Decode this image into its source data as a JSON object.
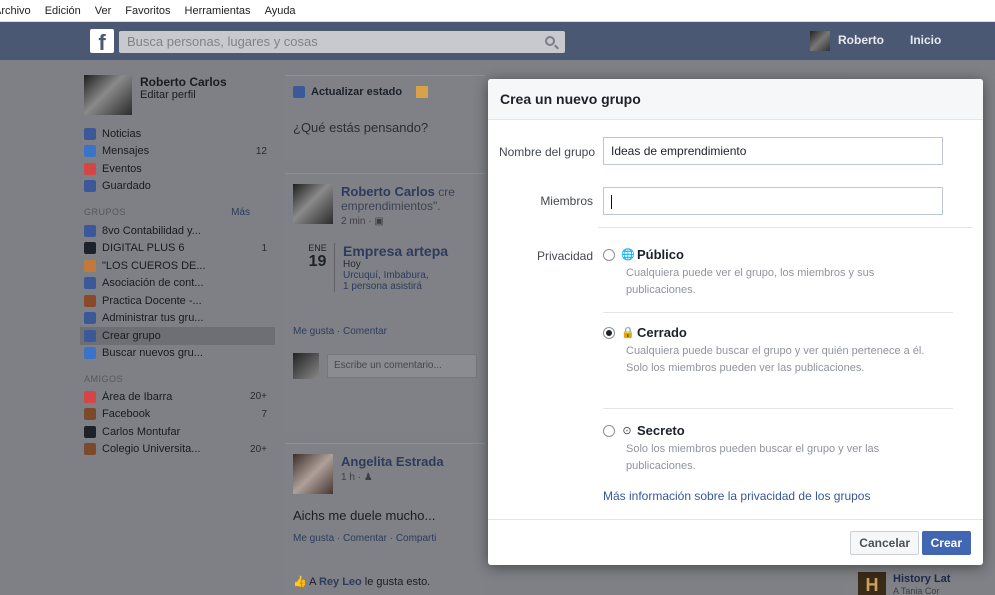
{
  "menubar": {
    "items": [
      "Archivo",
      "Edición",
      "Ver",
      "Favoritos",
      "Herramientas",
      "Ayuda"
    ]
  },
  "topbar": {
    "search_placeholder": "Busca personas, lugares y cosas",
    "user_name": "Roberto",
    "home_label": "Inicio"
  },
  "sidebar": {
    "profile_name": "Roberto Carlos",
    "profile_edit": "Editar perfil",
    "main_items": [
      {
        "label": "Noticias",
        "count": "",
        "icon": "news-feed-icon",
        "color": "#3b5998"
      },
      {
        "label": "Mensajes",
        "count": "12",
        "icon": "messages-icon",
        "color": "#3b73c8"
      },
      {
        "label": "Eventos",
        "count": "",
        "icon": "calendar-icon",
        "color": "#d64545"
      },
      {
        "label": "Guardado",
        "count": "",
        "icon": "saved-icon",
        "color": "#3b5998"
      }
    ],
    "groups_header": "GRUPOS",
    "groups_more": "Más",
    "groups": [
      {
        "label": "8vo Contabilidad y...",
        "count": "",
        "icon": "group-icon",
        "color": "#3b5998"
      },
      {
        "label": "DIGITAL PLUS 6",
        "count": "1",
        "icon": "graduation-cap-icon",
        "color": "#1d2129"
      },
      {
        "label": "\"LOS CUEROS DE...",
        "count": "",
        "icon": "group-feather-icon",
        "color": "#c07a3b"
      },
      {
        "label": "Asociación de cont...",
        "count": "",
        "icon": "group-icon",
        "color": "#3b5998"
      },
      {
        "label": "Practica Docente -...",
        "count": "",
        "icon": "book-icon",
        "color": "#8a4a2a"
      },
      {
        "label": "Administrar tus gru...",
        "count": "",
        "icon": "manage-groups-icon",
        "color": "#3b5998"
      },
      {
        "label": "Crear grupo",
        "count": "",
        "icon": "create-group-icon",
        "color": "#3b5998"
      },
      {
        "label": "Buscar nuevos gru...",
        "count": "",
        "icon": "discover-groups-icon",
        "color": "#3b73c8"
      }
    ],
    "friends_header": "AMIGOS",
    "friends": [
      {
        "label": "Área de Ibarra",
        "count": "20+",
        "icon": "location-pin-icon",
        "color": "#d64545"
      },
      {
        "label": "Facebook",
        "count": "7",
        "icon": "briefcase-icon",
        "color": "#7a4a2a"
      },
      {
        "label": "Carlos Montufar",
        "count": "",
        "icon": "graduation-cap-icon",
        "color": "#1d2129"
      },
      {
        "label": "Colegio Universita...",
        "count": "20+",
        "icon": "briefcase-icon",
        "color": "#7a4a2a"
      }
    ]
  },
  "composer": {
    "status_tab": "Actualizar estado",
    "prompt": "¿Qué estás pensando?"
  },
  "post1": {
    "author": "Roberto Carlos",
    "author_extra": "cre",
    "line2": "emprendimientos\".",
    "time": "2 min · ",
    "event_month": "ENE",
    "event_day": "19",
    "event_title": "Empresa artepa",
    "event_when": "Hoy",
    "event_where": "Urcuquí, Imbabura,",
    "event_attending": "1 persona asistirá",
    "actions": "Me gusta · Comentar",
    "comment_placeholder": "Escribe un comentario..."
  },
  "post2": {
    "author": "Angelita Estrada",
    "time": "1 h · ",
    "text": "Aichs me duele mucho...",
    "actions": "Me gusta · Comentar · Comparti"
  },
  "likes_row": {
    "prefix": "A ",
    "name": "Rey Leo",
    "suffix": " le gusta esto."
  },
  "right_column": {
    "history_title": "History Lat",
    "history_sub": "A Tania Cor"
  },
  "dialog": {
    "title": "Crea un nuevo grupo",
    "name_label": "Nombre del grupo",
    "name_value": "Ideas de emprendimiento",
    "members_label": "Miembros",
    "members_value": "",
    "privacy_label": "Privacidad",
    "options": [
      {
        "title": "Público",
        "desc": "Cualquiera puede ver el grupo, los miembros y sus publicaciones.",
        "selected": false,
        "icon": "globe-icon"
      },
      {
        "title": "Cerrado",
        "desc": "Cualquiera puede buscar el grupo y ver quién pertenece a él. Solo los miembros pueden ver las publicaciones.",
        "selected": true,
        "icon": "lock-icon"
      },
      {
        "title": "Secreto",
        "desc": "Solo los miembros pueden buscar el grupo y ver las publicaciones.",
        "selected": false,
        "icon": "secret-icon"
      }
    ],
    "privacy_link": "Más información sobre la privacidad de los grupos",
    "cancel_label": "Cancelar",
    "create_label": "Crear"
  }
}
